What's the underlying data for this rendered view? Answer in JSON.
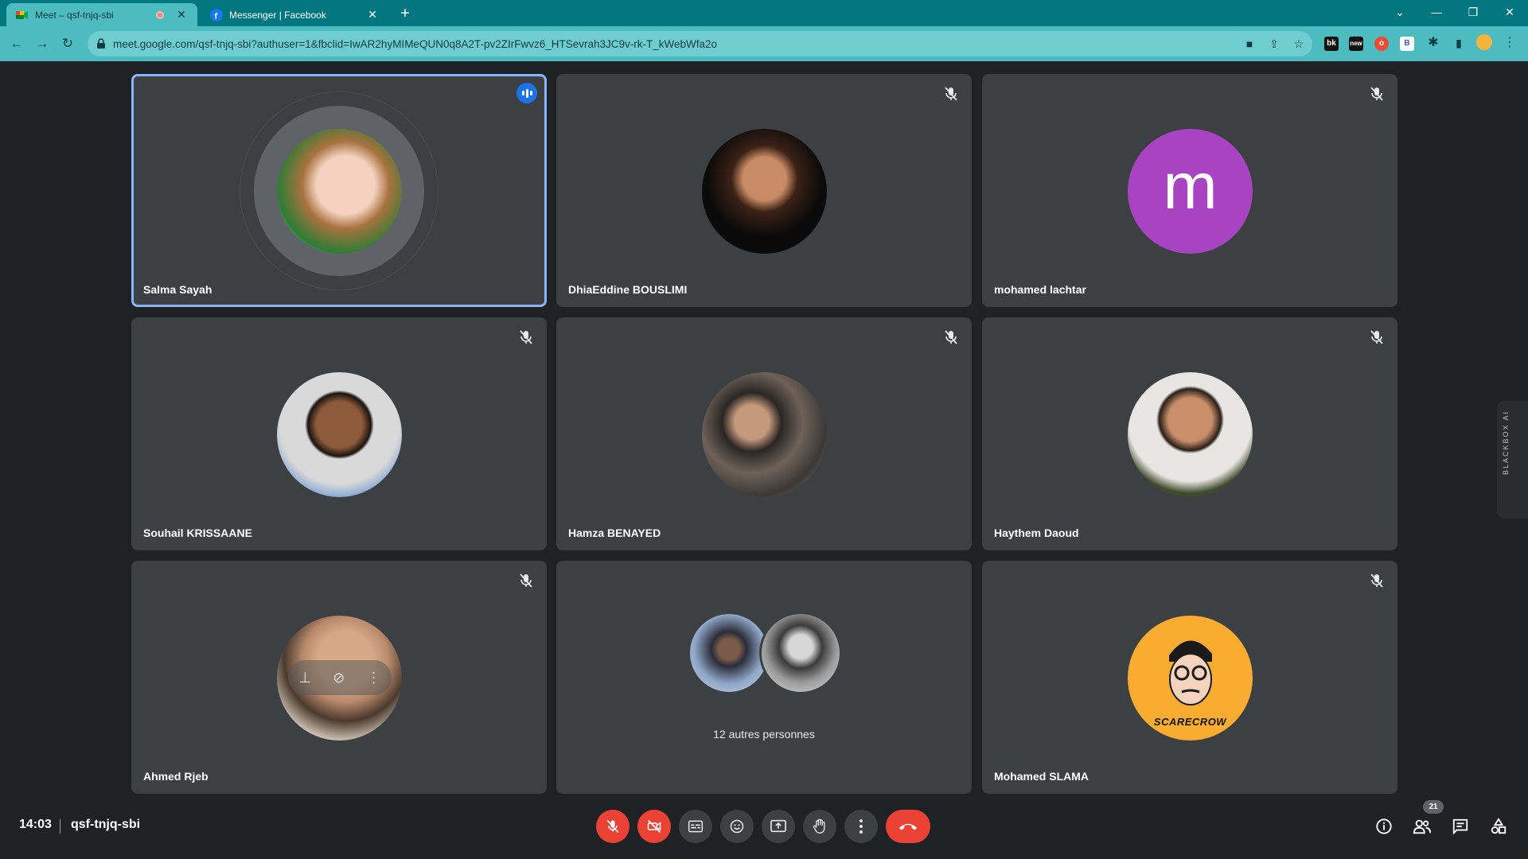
{
  "browser": {
    "tabs": [
      {
        "title": "Meet – qsf-tnjq-sbi",
        "active": true
      },
      {
        "title": "Messenger | Facebook",
        "active": false
      }
    ],
    "url": "meet.google.com/qsf-tnjq-sbi?authuser=1&fbclid=IwAR2hyMIMeQUN0q8A2T-pv2ZIrFwvz6_HTSevrah3JC9v-rk-T_kWebWfa2o",
    "extensions": [
      "bk",
      "new",
      "o",
      "B"
    ]
  },
  "colors": {
    "accent_teal": "#4dbcc1",
    "tile_bg": "#3c4043",
    "speaking_border": "#8ab4f8",
    "end_call_red": "#ea4335",
    "m_avatar": "#a843c2",
    "scarecrow_bg": "#f8ad31"
  },
  "participants": [
    {
      "name": "Salma Sayah",
      "speaking": true,
      "muted": false
    },
    {
      "name": "DhiaEddine BOUSLIMI",
      "speaking": false,
      "muted": true
    },
    {
      "name": "mohamed lachtar",
      "speaking": false,
      "muted": true,
      "initial": "m"
    },
    {
      "name": "Souhail KRISSAANE",
      "speaking": false,
      "muted": true
    },
    {
      "name": "Hamza BENAYED",
      "speaking": false,
      "muted": true
    },
    {
      "name": "Haythem Daoud",
      "speaking": false,
      "muted": true
    },
    {
      "name": "Ahmed Rjeb",
      "speaking": false,
      "muted": true
    },
    {
      "name": "Mohamed SLAMA",
      "speaking": false,
      "muted": true,
      "avatar_text": "SCARECROW"
    }
  ],
  "others_tile": {
    "label": "12 autres personnes"
  },
  "bottom_bar": {
    "time": "14:03",
    "meeting_code": "qsf-tnjq-sbi",
    "people_count": "21"
  },
  "side_panel": {
    "label": "BLACKBOX AI"
  }
}
